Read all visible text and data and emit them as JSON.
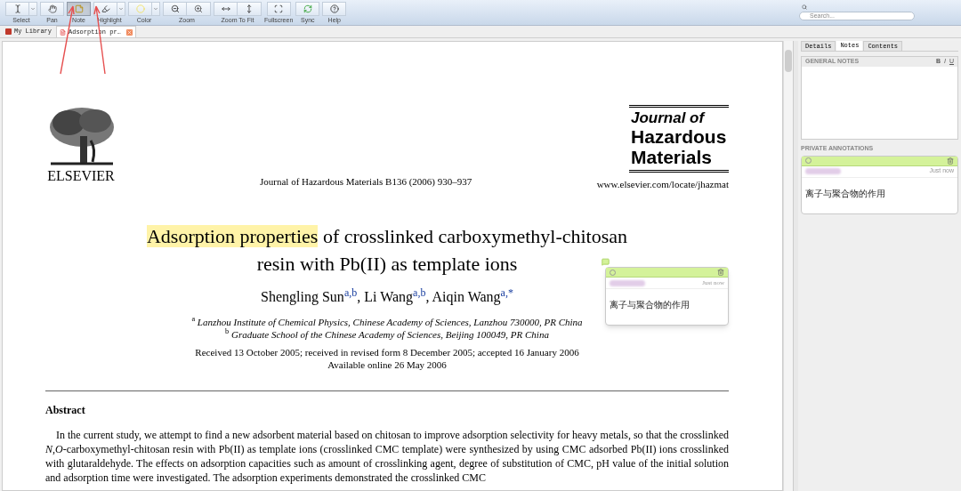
{
  "toolbar": {
    "groups": [
      {
        "label": "Select",
        "buttons": [
          {
            "kind": "select"
          }
        ],
        "dropdown": true,
        "selected": false
      },
      {
        "label": "Pan",
        "buttons": [
          {
            "kind": "pan"
          }
        ],
        "dropdown": false,
        "selected": false
      },
      {
        "label": "Note",
        "buttons": [
          {
            "kind": "note"
          }
        ],
        "dropdown": false,
        "selected": true
      },
      {
        "label": "Highlight",
        "buttons": [
          {
            "kind": "highlight"
          }
        ],
        "dropdown": true,
        "selected": false
      },
      {
        "label": "Color",
        "buttons": [
          {
            "kind": "color"
          }
        ],
        "dropdown": true,
        "selected": false
      },
      {
        "label": "Zoom",
        "buttons": [
          {
            "kind": "zoomout"
          },
          {
            "kind": "zoomin"
          }
        ],
        "dropdown": false,
        "selected": false
      },
      {
        "label": "Zoom To Fit",
        "buttons": [
          {
            "kind": "fitwidth"
          },
          {
            "kind": "fitheight"
          }
        ],
        "dropdown": false,
        "selected": false
      },
      {
        "label": "Fullscreen",
        "buttons": [
          {
            "kind": "fullscreen"
          }
        ],
        "dropdown": false,
        "selected": false
      },
      {
        "label": "Sync",
        "buttons": [
          {
            "kind": "sync"
          }
        ],
        "dropdown": false,
        "selected": false
      },
      {
        "label": "Help",
        "buttons": [
          {
            "kind": "help"
          }
        ],
        "dropdown": false,
        "selected": false
      }
    ],
    "search": {
      "placeholder": "Search..."
    }
  },
  "tabs": [
    {
      "label": "My Library",
      "selected": false,
      "closable": false
    },
    {
      "label": "Adsorption pr…",
      "selected": true,
      "closable": true
    }
  ],
  "document": {
    "publisher": "ELSEVIER",
    "citation": "Journal of Hazardous Materials B136 (2006) 930–937",
    "journal_logo": [
      "Journal of",
      "Hazardous",
      "Materials"
    ],
    "url": "www.elsevier.com/locate/jhazmat",
    "title_lines": [
      [
        {
          "text": "Adsorption properties",
          "highlighted": true
        },
        {
          "text": " of crosslinked carboxymethyl-chitosan",
          "highlighted": false
        }
      ],
      [
        {
          "text": "resin with Pb(II) as template ions",
          "highlighted": false
        }
      ]
    ],
    "authors": "Shengling Sun$^{a,b}$, Li Wang$^{a,b}$, Aiqin Wang$^{a,*}$",
    "affiliations": [
      "$^{a}$ Lanzhou Institute of Chemical Physics, Chinese Academy of Sciences, Lanzhou 730000, PR China",
      "$^{b}$ Graduate School of the Chinese Academy of Sciences, Beijing 100049, PR China"
    ],
    "dates": [
      "Received 13 October 2005; received in revised form 8 December 2005; accepted 16 January 2006",
      "Available online 26 May 2006"
    ],
    "abstract_heading": "Abstract",
    "abstract": "In the current study, we attempt to find a new adsorbent material based on chitosan to improve adsorption selectivity for heavy metals, so that the crosslinked *N*,*O*-carboxymethyl-chitosan resin with Pb(II) as template ions (crosslinked CMC template) were synthesized by using CMC adsorbed Pb(II) ions crosslinked with glutaraldehyde. The effects on adsorption capacities such as amount of crosslinking agent, degree of substitution of CMC, pH value of the initial solution and adsorption time were investigated. The adsorption experiments demonstrated the crosslinked CMC",
    "note_popup": {
      "time": "Just now",
      "text": "离子与聚合物的作用"
    }
  },
  "side_panel": {
    "tabs": [
      {
        "label": "Details",
        "selected": false
      },
      {
        "label": "Notes",
        "selected": true
      },
      {
        "label": "Contents",
        "selected": false
      }
    ],
    "general_notes": {
      "title": "GENERAL NOTES",
      "format_buttons": [
        "B",
        "I",
        "U"
      ]
    },
    "private_title": "PRIVATE ANNOTATIONS",
    "annotations": [
      {
        "time": "Just now",
        "text": "离子与聚合物的作用"
      }
    ]
  }
}
